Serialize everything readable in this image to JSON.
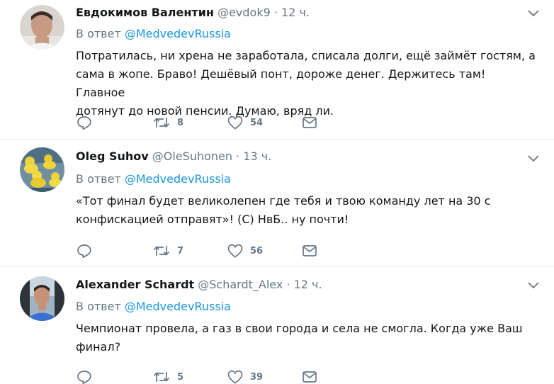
{
  "reply_prefix": "В ответ",
  "tweets": [
    {
      "name": "Евдокимов Валентин",
      "handle": "@evdok9",
      "separator": "·",
      "time": "12 ч.",
      "reply_to": "@MedvedevRussia",
      "text_lines": [
        "Потратилась, ни хрена не заработала, списала долги, ещё займёт гостям, а",
        "сама в жопе. Браво! Дешёвый понт, дороже денег. Держитесь там! Главное",
        "дотянут до новой пенсии. Думаю, вряд ли."
      ],
      "retweets": "8",
      "likes": "54"
    },
    {
      "name": "Oleg Suhov",
      "handle": "@OleSuhonen",
      "separator": "·",
      "time": "13 ч.",
      "reply_to": "@MedvedevRussia",
      "text_lines": [
        "«Тот финал будет великолепен где тебя и твою команду лет на 30 с",
        "конфискацией отправят»! (С) НвБ.. ну почти!"
      ],
      "retweets": "7",
      "likes": "56"
    },
    {
      "name": "Alexander Schardt",
      "handle": "@Schardt_Alex",
      "separator": "·",
      "time": "12 ч.",
      "reply_to": "@MedvedevRussia",
      "text_lines": [
        "Чемпионат провела, а газ в свои города и села не смогла. Когда уже Ваш",
        "финал?"
      ],
      "retweets": "5",
      "likes": "39"
    }
  ],
  "icons": {
    "reply": "reply-icon",
    "retweet": "retweet-icon",
    "like": "heart-icon",
    "dm": "envelope-icon",
    "more": "chevron-down-icon"
  },
  "colors": {
    "text": "#14171a",
    "secondary": "#657786",
    "link": "#1b95e0",
    "divider": "#e6ecf0"
  }
}
